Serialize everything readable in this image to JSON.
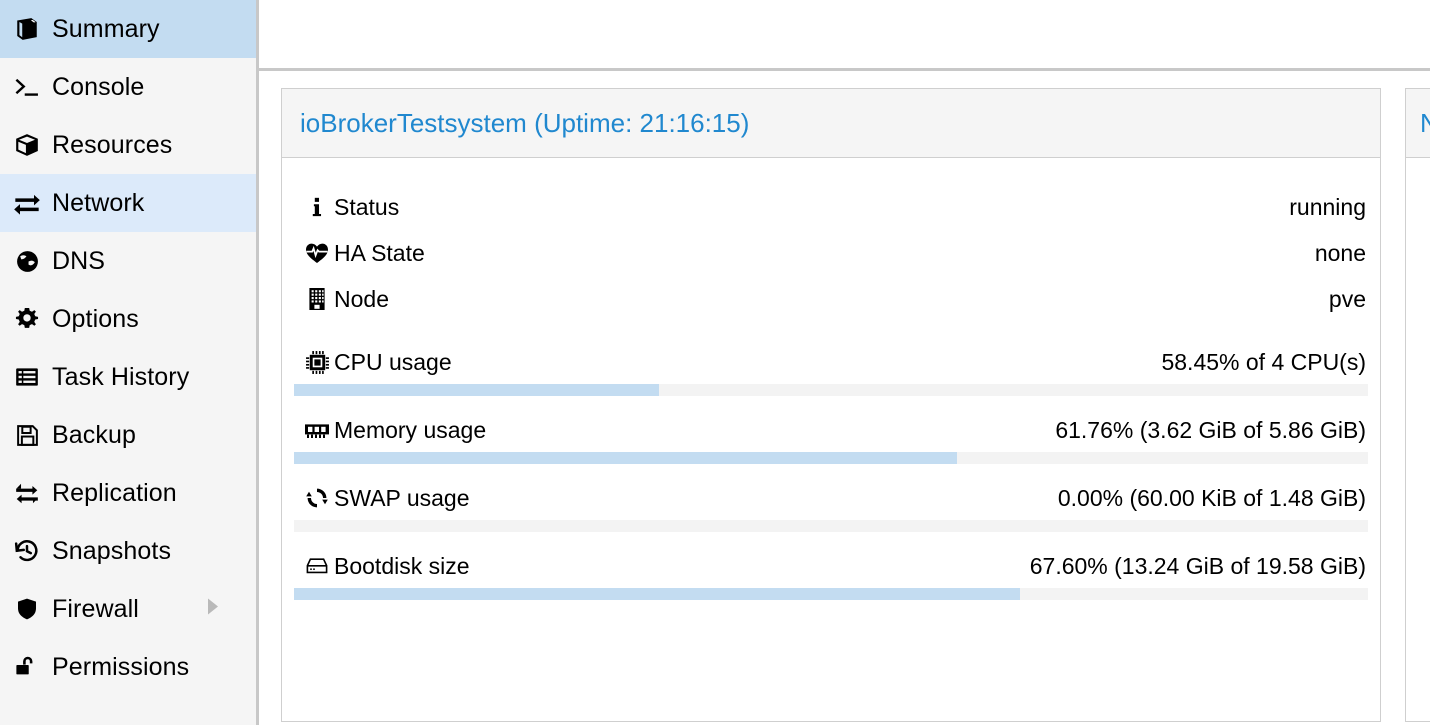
{
  "sidebar": {
    "items": [
      {
        "label": "Summary",
        "icon": "book-icon",
        "state": "selected"
      },
      {
        "label": "Console",
        "icon": "terminal-icon",
        "state": "normal"
      },
      {
        "label": "Resources",
        "icon": "cube-icon",
        "state": "normal"
      },
      {
        "label": "Network",
        "icon": "exchange-icon",
        "state": "hover"
      },
      {
        "label": "DNS",
        "icon": "globe-icon",
        "state": "normal"
      },
      {
        "label": "Options",
        "icon": "gear-icon",
        "state": "normal"
      },
      {
        "label": "Task History",
        "icon": "list-icon",
        "state": "normal"
      },
      {
        "label": "Backup",
        "icon": "floppy-icon",
        "state": "normal"
      },
      {
        "label": "Replication",
        "icon": "replication-icon",
        "state": "normal"
      },
      {
        "label": "Snapshots",
        "icon": "history-icon",
        "state": "normal"
      },
      {
        "label": "Firewall",
        "icon": "shield-icon",
        "state": "normal",
        "submenu": true
      },
      {
        "label": "Permissions",
        "icon": "unlock-icon",
        "state": "normal"
      }
    ]
  },
  "summary_panel": {
    "title": "ioBrokerTestsystem (Uptime: 21:16:15)",
    "stats": [
      {
        "icon": "info-icon",
        "label": "Status",
        "value": "running"
      },
      {
        "icon": "heartbeat-icon",
        "label": "HA State",
        "value": "none"
      },
      {
        "icon": "server-icon",
        "label": "Node",
        "value": "pve"
      }
    ],
    "gauges": [
      {
        "icon": "cpu-icon",
        "label": "CPU usage",
        "value": "58.45% of 4 CPU(s)",
        "percent": 34.0
      },
      {
        "icon": "memory-icon",
        "label": "Memory usage",
        "value": "61.76% (3.62 GiB of 5.86 GiB)",
        "percent": 61.76
      },
      {
        "icon": "swap-icon",
        "label": "SWAP usage",
        "value": "0.00% (60.00 KiB of 1.48 GiB)",
        "percent": 0.0
      },
      {
        "icon": "harddisk-icon",
        "label": "Bootdisk size",
        "value": "67.60% (13.24 GiB of 19.58 GiB)",
        "percent": 67.6
      }
    ]
  },
  "right_panel": {
    "title": "N"
  },
  "colors": {
    "accent_blue": "#2088cf",
    "selected_row": "#c3dcf1",
    "hover_row": "#dceafa",
    "progress_fill": "#c3dcf1",
    "progress_track": "#f3f3f3",
    "sidebar_bg": "#f5f5f5",
    "border": "#cfcfcf"
  }
}
